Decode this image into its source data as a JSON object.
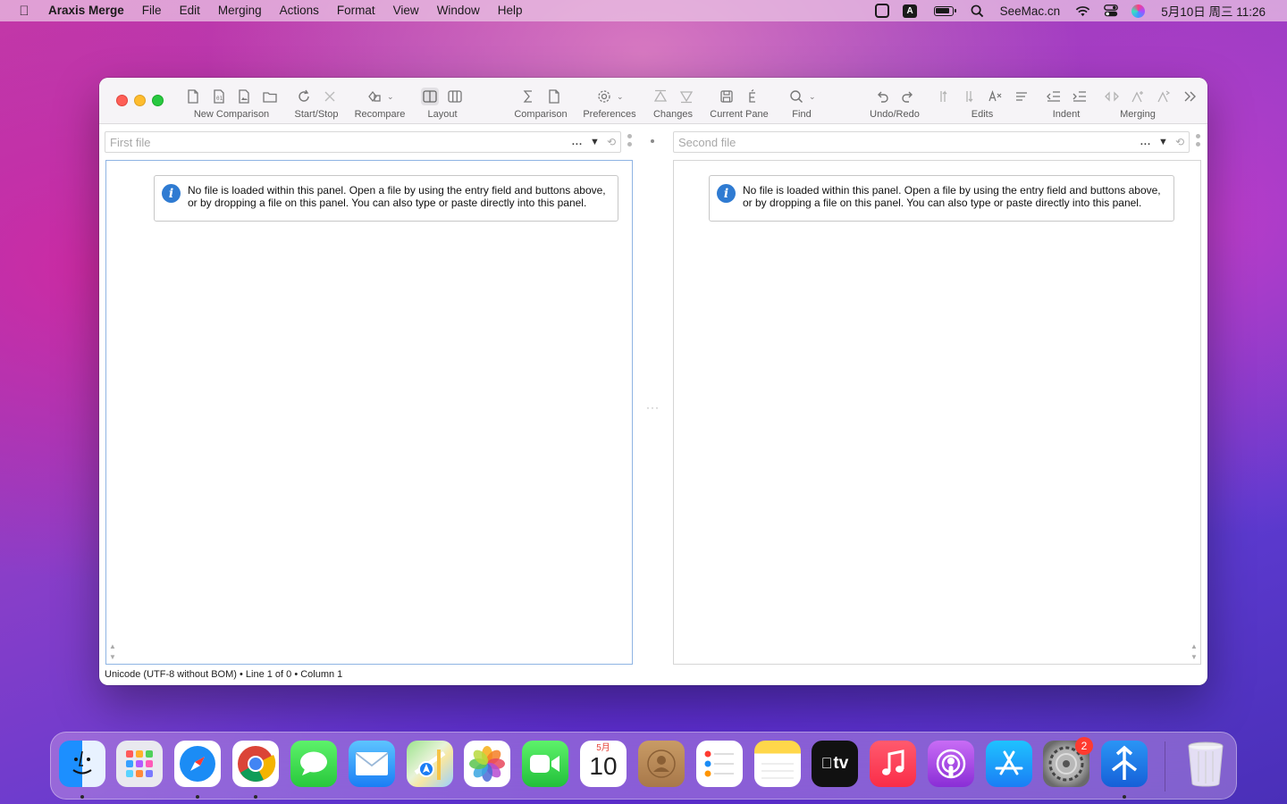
{
  "menubar": {
    "app_name": "Araxis Merge",
    "items": [
      "File",
      "Edit",
      "Merging",
      "Actions",
      "Format",
      "View",
      "Window",
      "Help"
    ],
    "status": {
      "keyboard_label": "A",
      "site": "SeeMac.cn",
      "datetime": "5月10日 周三  11:26"
    }
  },
  "toolbar": {
    "groups": [
      {
        "label": "New Comparison"
      },
      {
        "label": "Start/Stop"
      },
      {
        "label": "Recompare"
      },
      {
        "label": "Layout"
      },
      {
        "label": "Comparison"
      },
      {
        "label": "Preferences"
      },
      {
        "label": "Changes"
      },
      {
        "label": "Current Pane"
      },
      {
        "label": "Find"
      },
      {
        "label": "Undo/Redo"
      },
      {
        "label": "Edits"
      },
      {
        "label": "Indent"
      },
      {
        "label": "Merging"
      }
    ]
  },
  "left_pane": {
    "file_placeholder": "First file",
    "dots": "...",
    "info": "No file is loaded within this panel. Open a file by using the entry field and buttons above, or by dropping a file on this panel. You can also type or paste directly into this panel."
  },
  "right_pane": {
    "file_placeholder": "Second file",
    "dots": "...",
    "info": "No file is loaded within this panel. Open a file by using the entry field and buttons above, or by dropping a file on this panel. You can also type or paste directly into this panel."
  },
  "statusbar": {
    "text": "Unicode (UTF-8 without BOM) • Line 1 of 0 • Column 1"
  },
  "dock": {
    "calendar_month": "5月",
    "calendar_day": "10",
    "tv_label": "tv",
    "settings_badge": "2",
    "apps": [
      "finder-icon",
      "launchpad-icon",
      "safari-icon",
      "chrome-icon",
      "messages-icon",
      "mail-icon",
      "maps-icon",
      "photos-icon",
      "facetime-icon",
      "calendar-icon",
      "contacts-icon",
      "reminders-icon",
      "notes-icon",
      "apple-tv-icon",
      "music-icon",
      "podcasts-icon",
      "app-store-icon",
      "system-preferences-icon",
      "araxis-merge-icon",
      "trash-icon"
    ]
  },
  "colors": {
    "close": "#fe5f57",
    "minimize": "#febc2e",
    "maximize": "#28c840",
    "info_blue": "#2f7bd2",
    "badge_red": "#ff3b30"
  }
}
